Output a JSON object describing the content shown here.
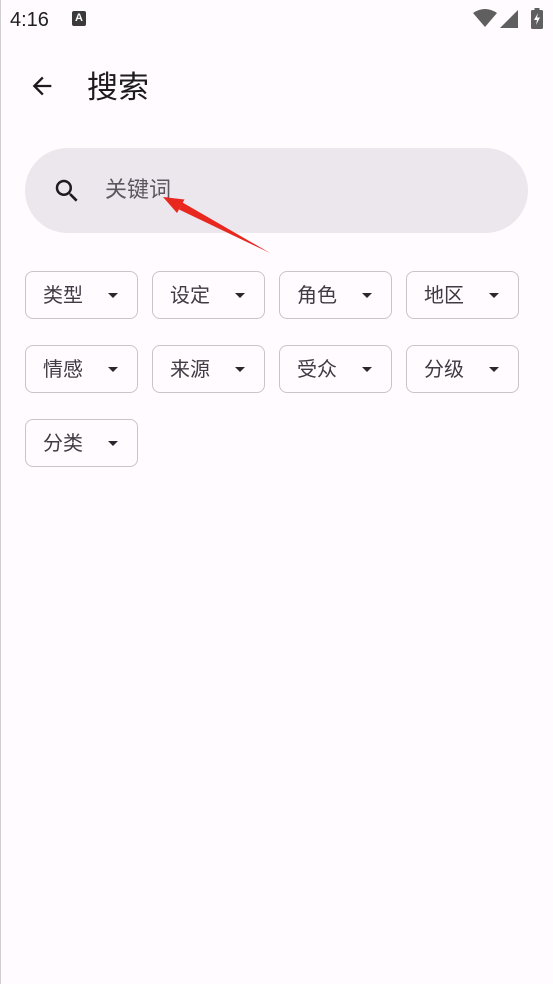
{
  "status_bar": {
    "time": "4:16",
    "notification_letter": "A",
    "notification_icon": "a-notification-icon",
    "right_icons": [
      "wifi-icon",
      "cell-signal-icon",
      "battery-charging-icon"
    ]
  },
  "app_bar": {
    "back_icon": "arrow-back-icon",
    "title": "搜索"
  },
  "search": {
    "icon": "search-icon",
    "placeholder": "关键词",
    "value": ""
  },
  "filters": [
    {
      "label": "类型",
      "icon": "arrow-drop-down-icon"
    },
    {
      "label": "设定",
      "icon": "arrow-drop-down-icon"
    },
    {
      "label": "角色",
      "icon": "arrow-drop-down-icon"
    },
    {
      "label": "地区",
      "icon": "arrow-drop-down-icon"
    },
    {
      "label": "情感",
      "icon": "arrow-drop-down-icon"
    },
    {
      "label": "来源",
      "icon": "arrow-drop-down-icon"
    },
    {
      "label": "受众",
      "icon": "arrow-drop-down-icon"
    },
    {
      "label": "分级",
      "icon": "arrow-drop-down-icon"
    },
    {
      "label": "分类",
      "icon": "arrow-drop-down-icon"
    }
  ],
  "annotation": {
    "type": "red-arrow-pointer",
    "color": "#e8271e"
  },
  "colors": {
    "background": "#fffbfe",
    "search_bar": "#ece6ed",
    "chip_border": "#c9c4cb",
    "text_primary": "#1d1b20",
    "placeholder": "#5b5660"
  }
}
